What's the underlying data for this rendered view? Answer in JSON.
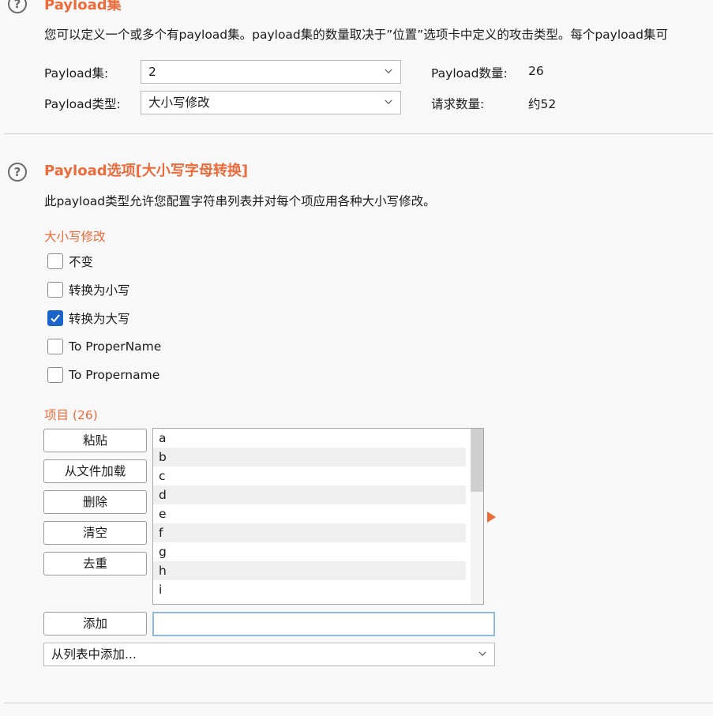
{
  "section1": {
    "title": "Payload集",
    "description": "您可以定义一个或多个有payload集。payload集的数量取决于”位置”选项卡中定义的攻击类型。每个payload集可",
    "set_label": "Payload集:",
    "set_value": "2",
    "type_label": "Payload类型:",
    "type_value": "大小写修改",
    "count_label": "Payload数量:",
    "count_value": "26",
    "requests_label": "请求数量:",
    "requests_value": "约52"
  },
  "section2": {
    "title": "Payload选项[大小写字母转换]",
    "description": "此payload类型允许您配置字符串列表并对每个项应用各种大小写修改。",
    "case_header": "大小写修改",
    "options": [
      {
        "label": "不变",
        "checked": false
      },
      {
        "label": "转换为小写",
        "checked": false
      },
      {
        "label": "转换为大写",
        "checked": true
      },
      {
        "label": "To ProperName",
        "checked": false
      },
      {
        "label": "To Propername",
        "checked": false
      }
    ],
    "items_header": "项目 (26)",
    "buttons": {
      "paste": "粘贴",
      "load": "从文件加载",
      "remove": "删除",
      "clear": "清空",
      "dedupe": "去重",
      "add": "添加"
    },
    "items": [
      "a",
      "b",
      "c",
      "d",
      "e",
      "f",
      "g",
      "h",
      "i"
    ],
    "add_input_value": "",
    "add_from_list": "从列表中添加..."
  },
  "colors": {
    "accent": "#ec6b3b",
    "checkbox": "#1a63c9"
  },
  "icons": [
    "help-icon",
    "chevron-down-icon",
    "check-icon",
    "arrow-right-icon"
  ]
}
